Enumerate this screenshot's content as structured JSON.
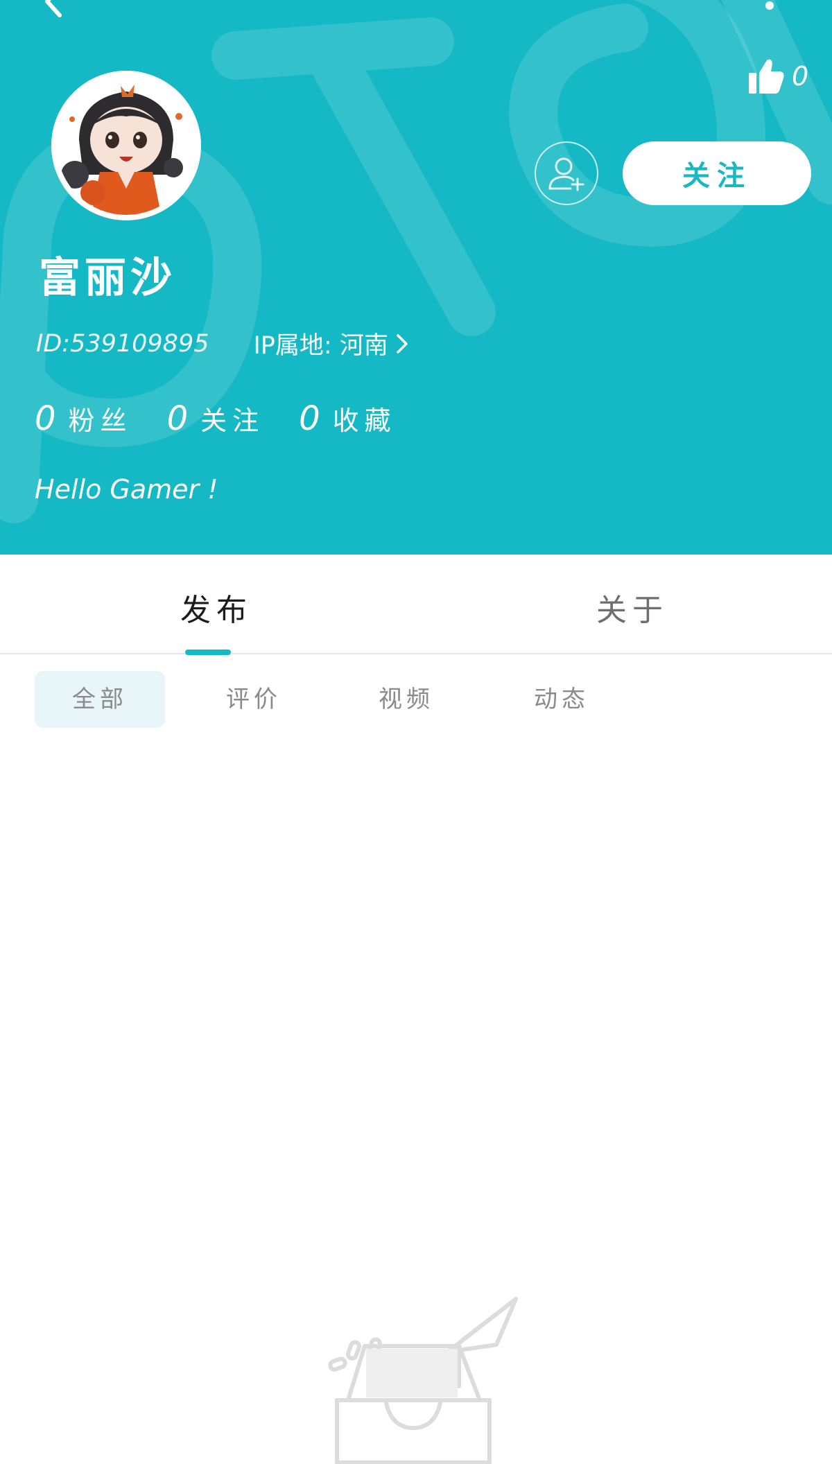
{
  "colors": {
    "brand": "#15b8c5",
    "header_bg": "#15b8c5",
    "chip_bg": "#e8f6f9",
    "text_dark": "#1c1c1c",
    "text_muted": "#8a8a8a"
  },
  "header": {
    "likes_count": "0",
    "follow_label": "关注",
    "icons": [
      "back-icon",
      "more-icon",
      "thumbs-up-icon",
      "add-friend-icon",
      "chevron-right-icon"
    ]
  },
  "profile": {
    "name": "富丽沙",
    "id_text": "ID:539109895",
    "ip_text": "IP属地: 河南",
    "bio": "Hello Gamer !"
  },
  "stats": [
    {
      "value": "0",
      "label": "粉丝"
    },
    {
      "value": "0",
      "label": "关注"
    },
    {
      "value": "0",
      "label": "收藏"
    }
  ],
  "tabs": {
    "publish": "发布",
    "about": "关于",
    "active": "发布"
  },
  "filters": {
    "all": "全部",
    "review": "评价",
    "video": "视频",
    "feed": "动态",
    "active": "全部"
  }
}
